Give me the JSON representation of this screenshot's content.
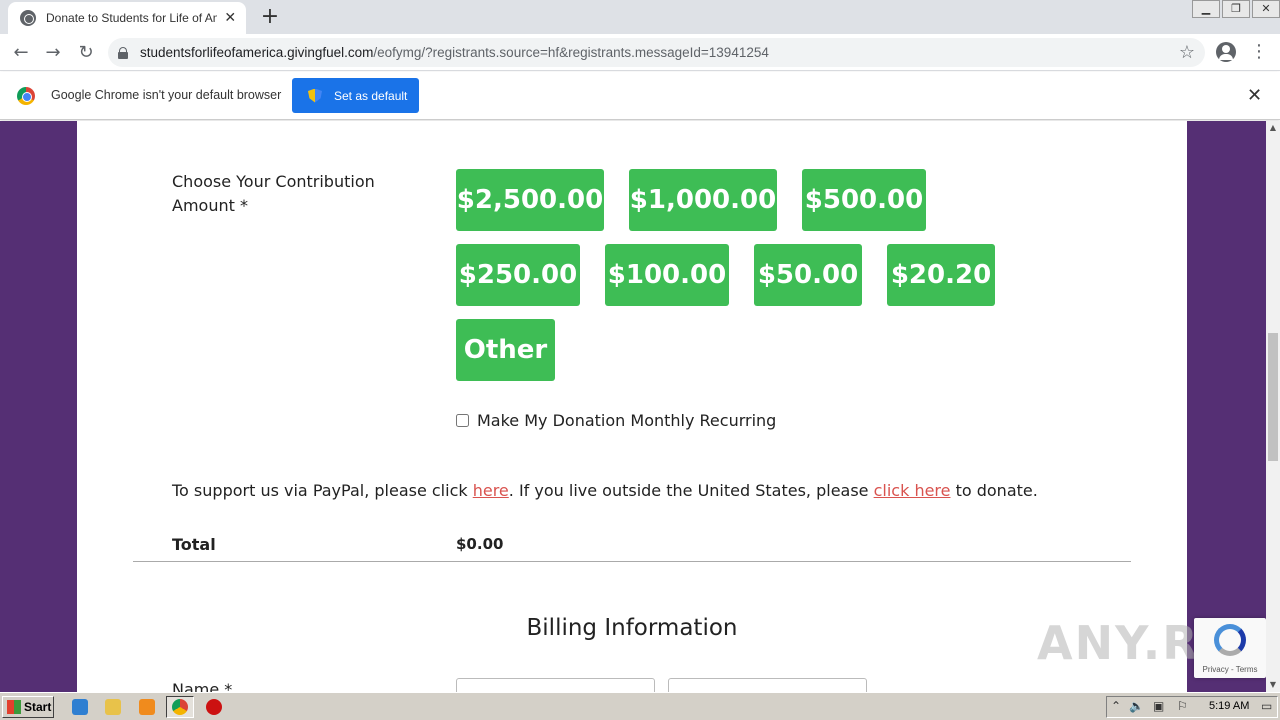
{
  "browser": {
    "tab_title": "Donate to Students for Life of America",
    "url_host": "studentsforlifeofamerica.givingfuel.com",
    "url_path": "/eofymg/?registrants.source=hf&registrants.messageId=13941254",
    "infobar_text": "Google Chrome isn't your default browser",
    "set_default_label": "Set as default"
  },
  "form": {
    "contribution_label": "Choose Your Contribution Amount  *",
    "amounts": [
      "$2,500.00",
      "$1,000.00",
      "$500.00",
      "$250.00",
      "$100.00",
      "$50.00",
      "$20.20",
      "Other"
    ],
    "recurring_label": "Make My Donation Monthly Recurring",
    "paypal_prefix": "To support us via PayPal, please click ",
    "paypal_link": "here",
    "paypal_middle": ". If you live outside the United States, please ",
    "outside_link": "click here",
    "paypal_suffix": " to donate.",
    "total_label": "Total",
    "total_value": "$0.00",
    "billing_heading": "Billing Information",
    "name_label": "Name  *"
  },
  "recaptcha": {
    "text": "Privacy - Terms"
  },
  "watermark": "ANY.RUN",
  "taskbar": {
    "start_label": "Start",
    "clock": "5:19 AM"
  },
  "colors": {
    "accent_green": "#3ebd55",
    "page_purple": "#552f74",
    "link_red": "#d9534f",
    "chrome_blue": "#1a73e8"
  }
}
